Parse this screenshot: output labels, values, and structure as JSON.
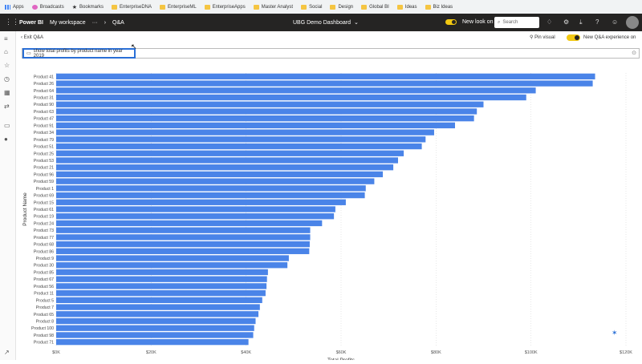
{
  "bookmarks": [
    "Apps",
    "Broadcasts",
    "Bookmarks",
    "EnterpriseDNA",
    "EnterpriseML",
    "EnterpriseApps",
    "Master Analyst",
    "Social",
    "Design",
    "Global BI",
    "Ideas",
    "Biz Ideas"
  ],
  "header": {
    "brand": "Power BI",
    "workspace": "My workspace",
    "ellipsis": "···",
    "crumb": "Q&A",
    "dashboard": "UBG Demo Dashboard",
    "new_look": "New look on",
    "search_placeholder": "Search"
  },
  "toolbar": {
    "exit": "Exit Q&A",
    "pin": "Pin visual",
    "new_qa": "New Q&A experience on"
  },
  "qa": {
    "query": "show total profits by product name in year 2019"
  },
  "chart_data": {
    "type": "bar",
    "orientation": "horizontal",
    "xlabel": "Total Profits",
    "ylabel": "Product Name",
    "xlim": [
      0,
      120000
    ],
    "xticks": [
      "$0K",
      "$20K",
      "$40K",
      "$60K",
      "$80K",
      "$100K",
      "$120K"
    ],
    "bar_color": "#4a84e8",
    "categories": [
      "Product 41",
      "Product 26",
      "Product 64",
      "Product 31",
      "Product 90",
      "Product 63",
      "Product 47",
      "Product 91",
      "Product 34",
      "Product 79",
      "Product 51",
      "Product 25",
      "Product 53",
      "Product 21",
      "Product 96",
      "Product 59",
      "Product 1",
      "Product 69",
      "Product 15",
      "Product 61",
      "Product 19",
      "Product 24",
      "Product 73",
      "Product 77",
      "Product 68",
      "Product 86",
      "Product 9",
      "Product 30",
      "Product 85",
      "Product 67",
      "Product 56",
      "Product 11",
      "Product 5",
      "Product 7",
      "Product 65",
      "Product 8",
      "Product 100",
      "Product 98",
      "Product 71"
    ],
    "values": [
      113500,
      113000,
      101000,
      99000,
      90000,
      88600,
      88000,
      84000,
      79600,
      77800,
      77000,
      73200,
      72000,
      71000,
      68800,
      67000,
      65200,
      65000,
      61000,
      58800,
      58500,
      56000,
      53500,
      53500,
      53400,
      53300,
      49000,
      48700,
      44600,
      44400,
      44300,
      44100,
      43400,
      42900,
      42600,
      42000,
      41700,
      41500,
      40500
    ]
  }
}
